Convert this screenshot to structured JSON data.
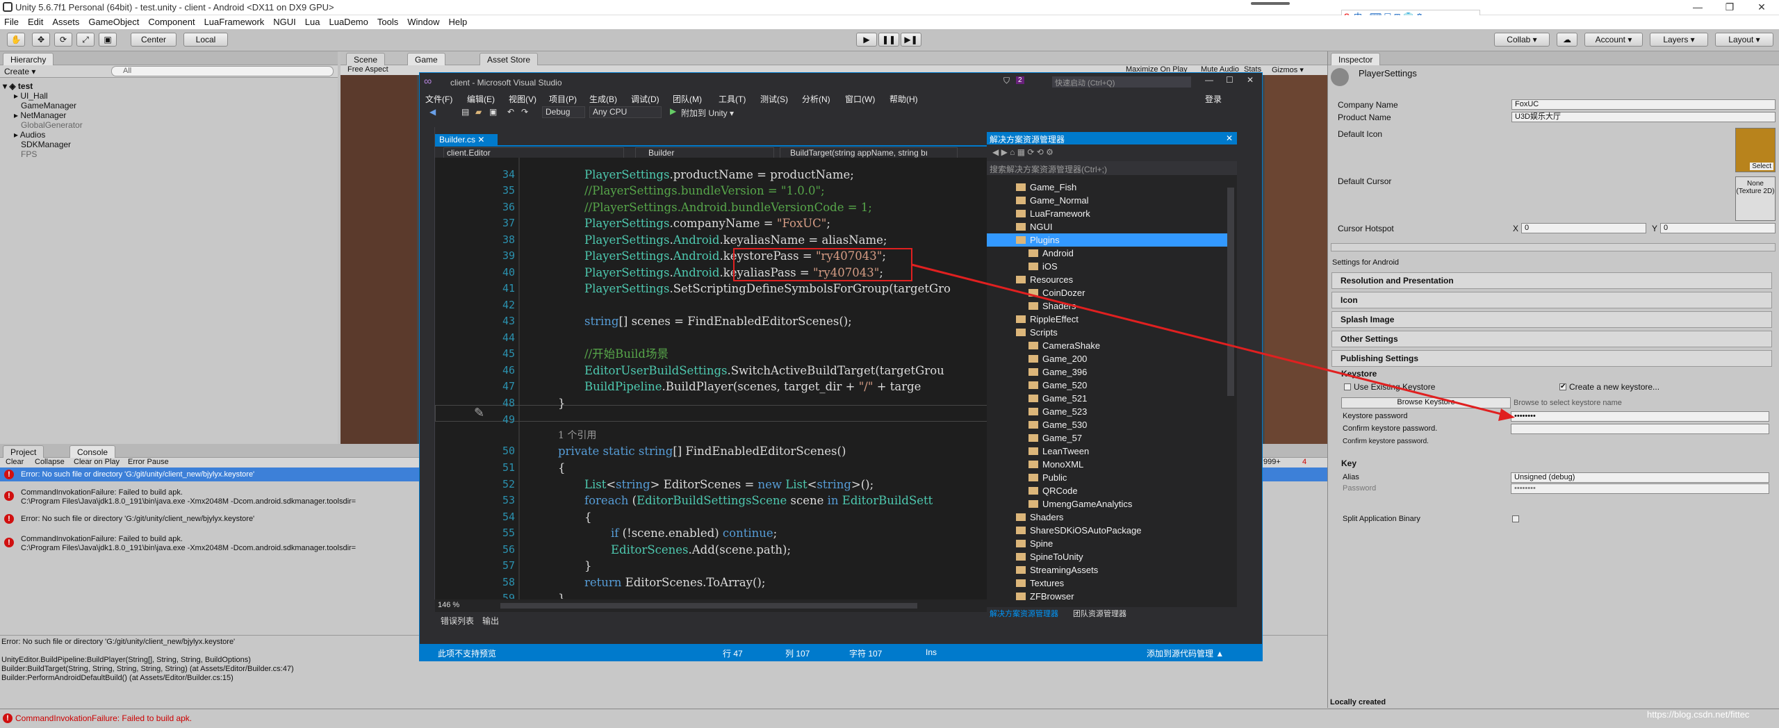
{
  "unity": {
    "title": "Unity 5.6.7f1 Personal (64bit) - test.unity - client - Android <DX11 on DX9 GPU>",
    "menu": [
      "File",
      "Edit",
      "Assets",
      "GameObject",
      "Component",
      "LuaFramework",
      "NGUI",
      "Lua",
      "LuaDemo",
      "Tools",
      "Window",
      "Help"
    ],
    "toolbar": {
      "center": "Center",
      "local": "Local",
      "collab": "Collab ▾",
      "account": "Account ▾",
      "layers": "Layers ▾",
      "layout": "Layout ▾"
    },
    "hierarchy": {
      "tab": "Hierarchy",
      "create": "Create ▾",
      "search": "All",
      "scene": "test",
      "items": [
        "UI_Hall",
        "GameManager",
        "NetManager",
        "GlobalGenerator",
        "Audios",
        "SDKManager",
        "FPS"
      ]
    },
    "scene_tabs": {
      "scene": "Scene",
      "game": "Game",
      "asset_store": "Asset Store",
      "aspect": "Free Aspect",
      "maximize": "Maximize On Play",
      "mute": "Mute Audio",
      "stats": "Stats",
      "gizmos": "Gizmos ▾"
    },
    "console": {
      "project_tab": "Project",
      "console_tab": "Console",
      "clear": "Clear",
      "collapse": "Collapse",
      "clear_on_play": "Clear on Play",
      "error_pause": "Error Pause",
      "count_warn": "999+",
      "count_err": "4",
      "rows": [
        {
          "l1": "Error: No such file or directory 'G:/git/unity/client_new/bjylyx.keystore'",
          "l2": ""
        },
        {
          "l1": "CommandInvokationFailure: Failed to build apk.",
          "l2": "C:\\Program Files\\Java\\jdk1.8.0_191\\bin\\java.exe -Xmx2048M -Dcom.android.sdkmanager.toolsdir="
        },
        {
          "l1": "Error: No such file or directory 'G:/git/unity/client_new/bjylyx.keystore'",
          "l2": ""
        },
        {
          "l1": "CommandInvokationFailure: Failed to build apk.",
          "l2": "C:\\Program Files\\Java\\jdk1.8.0_191\\bin\\java.exe -Xmx2048M -Dcom.android.sdkmanager.toolsdir="
        }
      ],
      "detail": [
        "Error: No such file or directory 'G:/git/unity/client_new/bjylyx.keystore'",
        "",
        "UnityEditor.BuildPipeline:BuildPlayer(String[], String, String, BuildOptions)",
        "Builder:BuildTarget(String, String, String, String, String) (at Assets/Editor/Builder.cs:47)",
        "Builder:PerformAndroidDefaultBuild() (at Assets/Editor/Builder.cs:15)"
      ],
      "status": "CommandInvokationFailure: Failed to build apk."
    },
    "inspector": {
      "tab": "Inspector",
      "title": "PlayerSettings",
      "company_label": "Company Name",
      "company": "FoxUC",
      "product_label": "Product Name",
      "product": "U3D娱乐大厅",
      "default_icon": "Default Icon",
      "default_cursor": "Default Cursor",
      "select": "Select",
      "none_texture": "None (Texture 2D)",
      "cursor_hotspot": "Cursor Hotspot",
      "x": "X",
      "x_val": "0",
      "y": "Y",
      "y_val": "0",
      "settings_for": "Settings for Android",
      "sections": [
        "Resolution and Presentation",
        "Icon",
        "Splash Image",
        "Other Settings",
        "Publishing Settings"
      ],
      "keystore": "Keystore",
      "use_existing": "Use Existing Keystore",
      "create_new": "Create a new keystore...",
      "browse": "Browse Keystore",
      "browse_hint": "Browse to select keystore name",
      "ks_password": "Keystore password",
      "ks_password_val": "••••••••",
      "confirm": "Confirm keystore password.",
      "confirm2": "Confirm keystore password.",
      "key": "Key",
      "alias": "Alias",
      "alias_val": "Unsigned (debug)",
      "password": "Password",
      "password_val": "••••••••",
      "split": "Split Application Binary",
      "locally": "Locally created"
    }
  },
  "vs": {
    "title": "client - Microsoft Visual Studio",
    "badge": "2",
    "quick": "快速启动 (Ctrl+Q)",
    "login": "登录",
    "menu": [
      "文件(F)",
      "编辑(E)",
      "视图(V)",
      "项目(P)",
      "生成(B)",
      "调试(D)",
      "团队(M)",
      "工具(T)",
      "测试(S)",
      "分析(N)",
      "窗口(W)",
      "帮助(H)"
    ],
    "config": "Debug",
    "platform": "Any CPU",
    "attach": "附加到 Unity ▾",
    "file_tab": "Builder.cs",
    "nav1": "client.Editor",
    "nav2": "Builder",
    "nav3": "BuildTarget(string appName, string bı",
    "zoom": "146 %",
    "bottom_tabs": [
      "错误列表",
      "输出"
    ],
    "status": {
      "msg": "此项不支持预览",
      "row": "行 47",
      "col": "列 107",
      "ch": "字符 107",
      "ins": "Ins",
      "src": "添加到源代码管理 ▲"
    },
    "lines": [
      "34",
      "35",
      "36",
      "37",
      "38",
      "39",
      "40",
      "41",
      "42",
      "43",
      "44",
      "45",
      "46",
      "47",
      "48",
      "49",
      "",
      "50",
      "51",
      "52",
      "53",
      "54",
      "55",
      "56",
      "57",
      "58",
      "59"
    ],
    "refs": "1 个引用",
    "se": {
      "title": "解决方案资源管理器",
      "search": "搜索解决方案资源管理器(Ctrl+;)",
      "tab1": "解决方案资源管理器",
      "tab2": "团队资源管理器",
      "items": [
        "Game_Fish",
        "Game_Normal",
        "LuaFramework",
        "NGUI",
        "Plugins",
        "Android",
        "iOS",
        "Resources",
        "CoinDozer",
        "Shaders",
        "RippleEffect",
        "Scripts",
        "CameraShake",
        "Game_200",
        "Game_396",
        "Game_520",
        "Game_521",
        "Game_523",
        "Game_530",
        "Game_57",
        "LeanTween",
        "MonoXML",
        "Public",
        "QRCode",
        "UmengGameAnalytics",
        "Shaders",
        "ShareSDKiOSAutoPackage",
        "Spine",
        "SpineToUnity",
        "StreamingAssets",
        "Textures",
        "ZFBrowser"
      ]
    }
  },
  "watermark": "https://blog.csdn.net/fittec"
}
